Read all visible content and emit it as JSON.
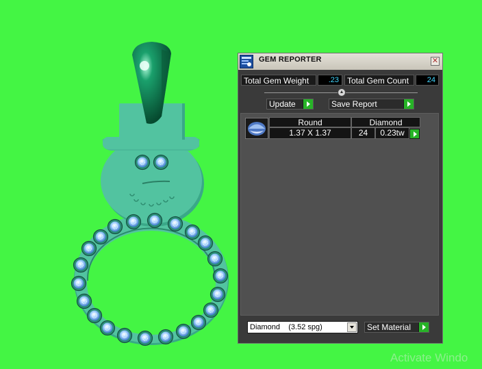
{
  "panel": {
    "title": "GEM REPORTER",
    "close_glyph": "✕",
    "title_icon": "gem-reporter-app-icon",
    "total_weight_label": "Total Gem Weight",
    "total_weight_value": ".23",
    "total_count_label": "Total Gem Count",
    "total_count_value": "24",
    "update_label": "Update",
    "save_report_label": "Save Report",
    "gem_rows": [
      {
        "icon": "round-gem-icon",
        "shape": "Round",
        "size": "1.37 X 1.37",
        "material": "Diamond",
        "count": "24",
        "weight": "0.23tw"
      }
    ],
    "material_select": {
      "selected": "Diamond    (3.52 spg)"
    },
    "set_material_label": "Set Material"
  },
  "viewport": {
    "model": "snowman-ring",
    "background_color": "#44f544",
    "model_color": "#52c3a0",
    "bail_color": "#0b7a4e",
    "gem_color": "#9fd4ff"
  },
  "watermark": "Activate Windo"
}
